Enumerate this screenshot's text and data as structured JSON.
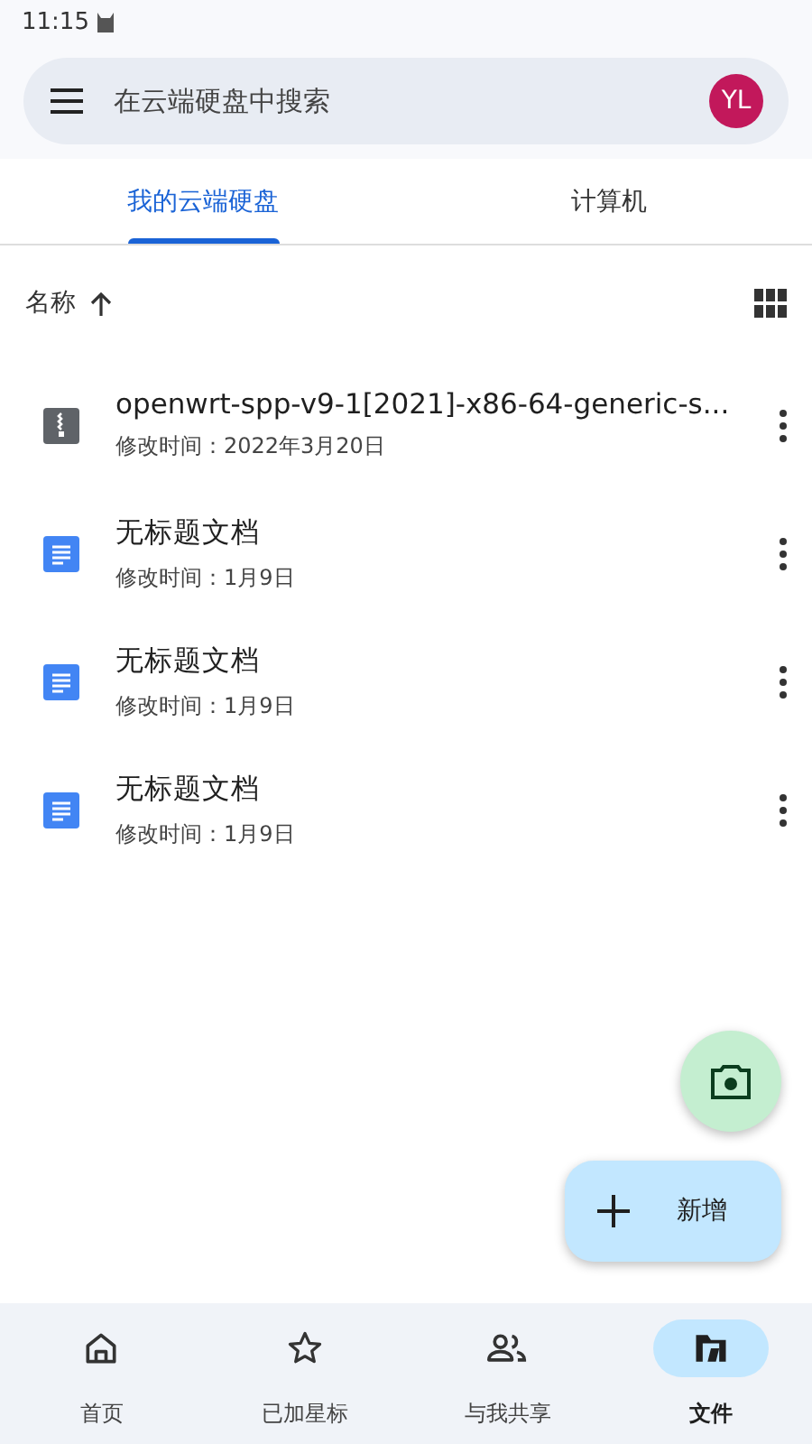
{
  "status_bar": {
    "time": "11:15"
  },
  "search": {
    "placeholder": "在云端硬盘中搜索",
    "avatar": "YL"
  },
  "tabs": [
    {
      "label": "我的云端硬盘",
      "selected": true
    },
    {
      "label": "计算机",
      "selected": false
    }
  ],
  "sort": {
    "label": "名称"
  },
  "files": [
    {
      "kind": "archive",
      "name": "openwrt-spp-v9-1[2021]-x86-64-generic-s...",
      "modified": "修改时间：2022年3月20日"
    },
    {
      "kind": "document",
      "name": "无标题文档",
      "modified": "修改时间：1月9日"
    },
    {
      "kind": "document",
      "name": "无标题文档",
      "modified": "修改时间：1月9日"
    },
    {
      "kind": "document",
      "name": "无标题文档",
      "modified": "修改时间：1月9日"
    }
  ],
  "new_button": {
    "label": "新增"
  },
  "bottom_nav": [
    {
      "kind": "home",
      "label": "首页",
      "selected": false
    },
    {
      "kind": "starred",
      "label": "已加星标",
      "selected": false
    },
    {
      "kind": "shared",
      "label": "与我共享",
      "selected": false
    },
    {
      "kind": "files",
      "label": "文件",
      "selected": true
    }
  ]
}
